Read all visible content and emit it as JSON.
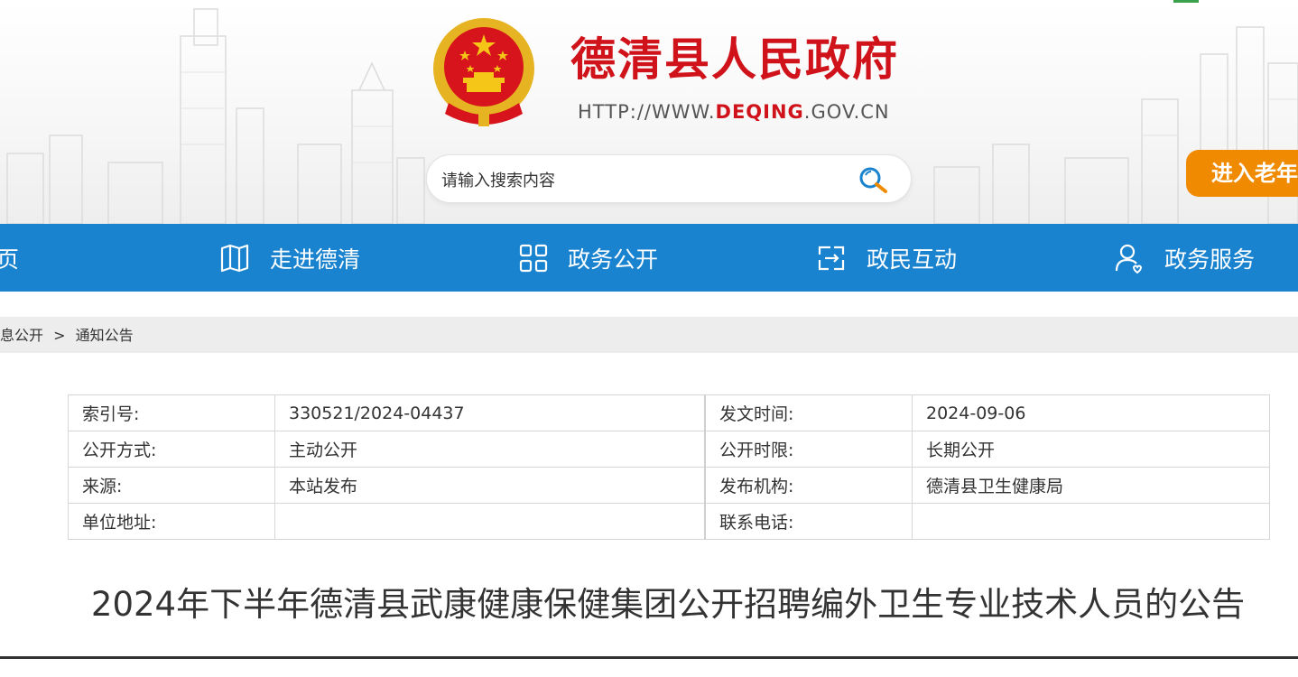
{
  "header": {
    "site_title": "德清县人民政府",
    "url_prefix": "HTTP://WWW.",
    "url_highlight": "DEQING",
    "url_suffix": ".GOV.CN",
    "elder_button": "进入老年",
    "colors": {
      "title_red": "#d0121b",
      "elder_orange": "#f08a00"
    }
  },
  "search": {
    "placeholder": "请输入搜索内容",
    "icon": "magnifier-icon"
  },
  "nav": {
    "color": "#1a83cf",
    "items": [
      {
        "label": "页",
        "icon": ""
      },
      {
        "label": "走进德清",
        "icon": "map-icon"
      },
      {
        "label": "政务公开",
        "icon": "grid-icon"
      },
      {
        "label": "政民互动",
        "icon": "interaction-icon"
      },
      {
        "label": "政务服务",
        "icon": "user-service-icon"
      }
    ]
  },
  "breadcrumb": {
    "items": [
      "信息公开",
      "通知公告"
    ],
    "separator": ">"
  },
  "info_table": {
    "rows": [
      {
        "k1": "索引号:",
        "v1": "330521/2024-04437",
        "k2": "发文时间:",
        "v2": "2024-09-06"
      },
      {
        "k1": "公开方式:",
        "v1": "主动公开",
        "k2": "公开时限:",
        "v2": "长期公开"
      },
      {
        "k1": "来源:",
        "v1": "本站发布",
        "k2": "发布机构:",
        "v2": "德清县卫生健康局"
      },
      {
        "k1": "单位地址:",
        "v1": "",
        "k2": "联系电话:",
        "v2": ""
      }
    ]
  },
  "article": {
    "title": "2024年下半年德清县武康健康保健集团公开招聘编外卫生专业技术人员的公告"
  }
}
